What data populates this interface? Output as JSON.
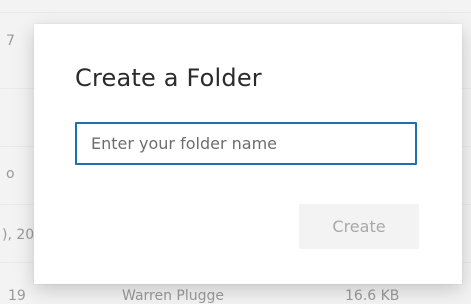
{
  "background_list": {
    "fragments": [
      "7",
      "o",
      "), 20",
      "19",
      "Warren Plugge",
      "16.6 KB"
    ]
  },
  "dialog": {
    "title": "Create a Folder",
    "input": {
      "placeholder": "Enter your folder name",
      "value": ""
    },
    "create_label": "Create"
  },
  "colors": {
    "accent": "#1f6fb3",
    "disabled_button_bg": "#f3f3f3",
    "disabled_button_text": "#a8a8a8"
  }
}
